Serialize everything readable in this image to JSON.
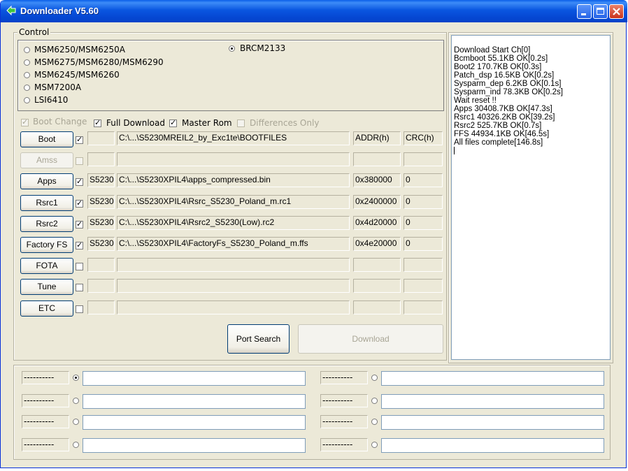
{
  "window": {
    "title": "Downloader V5.60"
  },
  "control": {
    "label": "Control",
    "radios": [
      "MSM6250/MSM6250A",
      "MSM6275/MSM6280/MSM6290",
      "MSM6245/MSM6260",
      "MSM7200A",
      "LSI6410"
    ],
    "brcm": "BRCM2133"
  },
  "options": {
    "boot_change": "Boot Change",
    "full_download": "Full Download",
    "master_rom": "Master Rom",
    "differences_only": "Differences Only"
  },
  "headers": {
    "addr": "ADDR(h)",
    "crc": "CRC(h)"
  },
  "rows": [
    {
      "label": "Boot",
      "checked": true,
      "enabled": true,
      "ver": "",
      "path": "C:\\...\\S5230MREIL2_by_Exc1te\\BOOTFILES",
      "addr": "",
      "crc": ""
    },
    {
      "label": "Amss",
      "checked": false,
      "enabled": false,
      "ver": "",
      "path": "",
      "addr": "",
      "crc": ""
    },
    {
      "label": "Apps",
      "checked": true,
      "enabled": true,
      "ver": "S5230",
      "path": "C:\\...\\S5230XPIL4\\apps_compressed.bin",
      "addr": "0x380000",
      "crc": "0"
    },
    {
      "label": "Rsrc1",
      "checked": true,
      "enabled": true,
      "ver": "S5230",
      "path": "C:\\...\\S5230XPIL4\\Rsrc_S5230_Poland_m.rc1",
      "addr": "0x2400000",
      "crc": "0"
    },
    {
      "label": "Rsrc2",
      "checked": true,
      "enabled": true,
      "ver": "S5230",
      "path": "C:\\...\\S5230XPIL4\\Rsrc2_S5230(Low).rc2",
      "addr": "0x4d20000",
      "crc": "0"
    },
    {
      "label": "Factory FS",
      "checked": true,
      "enabled": true,
      "ver": "S5230",
      "path": "C:\\...\\S5230XPIL4\\FactoryFs_S5230_Poland_m.ffs",
      "addr": "0x4e20000",
      "crc": "0"
    },
    {
      "label": "FOTA",
      "checked": false,
      "enabled": true,
      "ver": "",
      "path": "",
      "addr": "",
      "crc": ""
    },
    {
      "label": "Tune",
      "checked": false,
      "enabled": true,
      "ver": "",
      "path": "",
      "addr": "",
      "crc": ""
    },
    {
      "label": "ETC",
      "checked": false,
      "enabled": true,
      "ver": "",
      "path": "",
      "addr": "",
      "crc": ""
    }
  ],
  "buttons": {
    "port_search": "Port Search",
    "download": "Download"
  },
  "log": [
    "Download Start Ch[0]",
    "Bcmboot 55.1KB OK[0.2s]",
    "Boot2 170.7KB OK[0.3s]",
    "Patch_dsp 16.5KB OK[0.2s]",
    "Sysparm_dep 6.2KB OK[0.1s]",
    "Sysparm_ind 78.3KB OK[0.2s]",
    "Wait reset !!",
    "Apps 30408.7KB OK[47.3s]",
    "Rsrc1 40326.2KB OK[39.2s]",
    "Rsrc2 525.7KB OK[0.7s]",
    "FFS 44934.1KB OK[46.5s]",
    "All files complete[146.8s]"
  ],
  "ports": {
    "label": "----------",
    "selected_index": 0,
    "count": 8
  }
}
